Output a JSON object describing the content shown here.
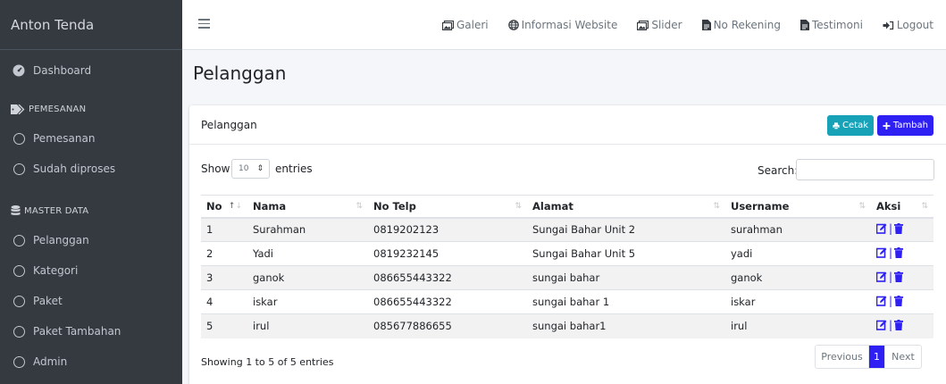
{
  "sidebar": {
    "brand": "Anton Tenda",
    "dashboard": "Dashboard",
    "section_pemesanan": "PEMESANAN",
    "pemesanan": "Pemesanan",
    "sudah_diproses": "Sudah diproses",
    "section_master": "MASTER DATA",
    "pelanggan": "Pelanggan",
    "kategori": "Kategori",
    "paket": "Paket",
    "paket_tambahan": "Paket Tambahan",
    "admin": "Admin"
  },
  "topnav": {
    "galeri": "Galeri",
    "informasi_website": "Informasi Website",
    "slider": "Slider",
    "no_rekening": "No Rekening",
    "testimoni": "Testimoni",
    "logout": "Logout"
  },
  "page": {
    "title": "Pelanggan",
    "card_title": "Pelanggan",
    "cetak": "Cetak",
    "tambah": "Tambah"
  },
  "table_controls": {
    "show": "Show",
    "length_value": "10",
    "entries": "entries",
    "search": "Search:"
  },
  "table": {
    "headers": [
      "No",
      "Nama",
      "No Telp",
      "Alamat",
      "Username",
      "Aksi"
    ],
    "rows": [
      [
        "1",
        "Surahman",
        "0819202123",
        "Sungai Bahar Unit 2",
        "surahman"
      ],
      [
        "2",
        "Yadi",
        "0819232145",
        "Sungai Bahar Unit 5",
        "yadi"
      ],
      [
        "3",
        "ganok",
        "086655443322",
        "sungai bahar",
        "ganok"
      ],
      [
        "4",
        "iskar",
        "086655443322",
        "sungai bahar 1",
        "iskar"
      ],
      [
        "5",
        "irul",
        "085677886655",
        "sungai bahar1",
        "irul"
      ]
    ]
  },
  "footer": {
    "info": "Showing 1 to 5 of 5 entries",
    "previous": "Previous",
    "page": "1",
    "next": "Next"
  },
  "colors": {
    "sidebar_bg": "#343a40",
    "primary": "#2e1ff2",
    "info": "#17a2b8"
  }
}
